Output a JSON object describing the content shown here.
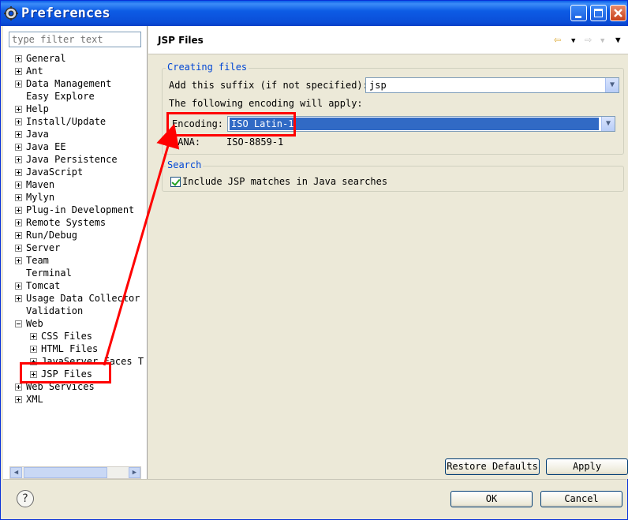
{
  "window": {
    "title": "Preferences"
  },
  "sidebar": {
    "filter_placeholder": "type filter text",
    "items": [
      {
        "label": "General",
        "expander": "plus"
      },
      {
        "label": "Ant",
        "expander": "plus"
      },
      {
        "label": "Data Management",
        "expander": "plus"
      },
      {
        "label": "Easy Explore",
        "expander": "none"
      },
      {
        "label": "Help",
        "expander": "plus"
      },
      {
        "label": "Install/Update",
        "expander": "plus"
      },
      {
        "label": "Java",
        "expander": "plus"
      },
      {
        "label": "Java EE",
        "expander": "plus"
      },
      {
        "label": "Java Persistence",
        "expander": "plus"
      },
      {
        "label": "JavaScript",
        "expander": "plus"
      },
      {
        "label": "Maven",
        "expander": "plus"
      },
      {
        "label": "Mylyn",
        "expander": "plus"
      },
      {
        "label": "Plug-in Development",
        "expander": "plus"
      },
      {
        "label": "Remote Systems",
        "expander": "plus"
      },
      {
        "label": "Run/Debug",
        "expander": "plus"
      },
      {
        "label": "Server",
        "expander": "plus"
      },
      {
        "label": "Team",
        "expander": "plus"
      },
      {
        "label": "Terminal",
        "expander": "none"
      },
      {
        "label": "Tomcat",
        "expander": "plus"
      },
      {
        "label": "Usage Data Collector",
        "expander": "plus"
      },
      {
        "label": "Validation",
        "expander": "none"
      },
      {
        "label": "Web",
        "expander": "minus"
      },
      {
        "label": "CSS Files",
        "expander": "plus",
        "child": true
      },
      {
        "label": "HTML Files",
        "expander": "plus",
        "child": true
      },
      {
        "label": "JavaServer Faces T",
        "expander": "plus",
        "child": true
      },
      {
        "label": "JSP Files",
        "expander": "plus",
        "child": true,
        "selected": true
      },
      {
        "label": "Web Services",
        "expander": "plus"
      },
      {
        "label": "XML",
        "expander": "plus"
      }
    ]
  },
  "page": {
    "title": "JSP Files",
    "creating_files": {
      "group_title": "Creating files",
      "suffix_label": "Add this suffix (if not specified):",
      "suffix_value": "jsp",
      "encoding_note": "The following encoding will apply:",
      "encoding_label": "Encoding:",
      "encoding_value": "ISO Latin-1",
      "iana_label": "IANA:",
      "iana_value": "ISO-8859-1"
    },
    "search": {
      "group_title": "Search",
      "include_label": "Include JSP matches in Java searches",
      "include_checked": true
    },
    "restore_defaults": "Restore Defaults",
    "apply": "Apply"
  },
  "footer": {
    "help_icon": "?",
    "ok": "OK",
    "cancel": "Cancel"
  },
  "colors": {
    "annotation": "#ff0000",
    "titlebar": "#0a4ed8",
    "group_title": "#0046d5",
    "selection": "#316ac5"
  }
}
